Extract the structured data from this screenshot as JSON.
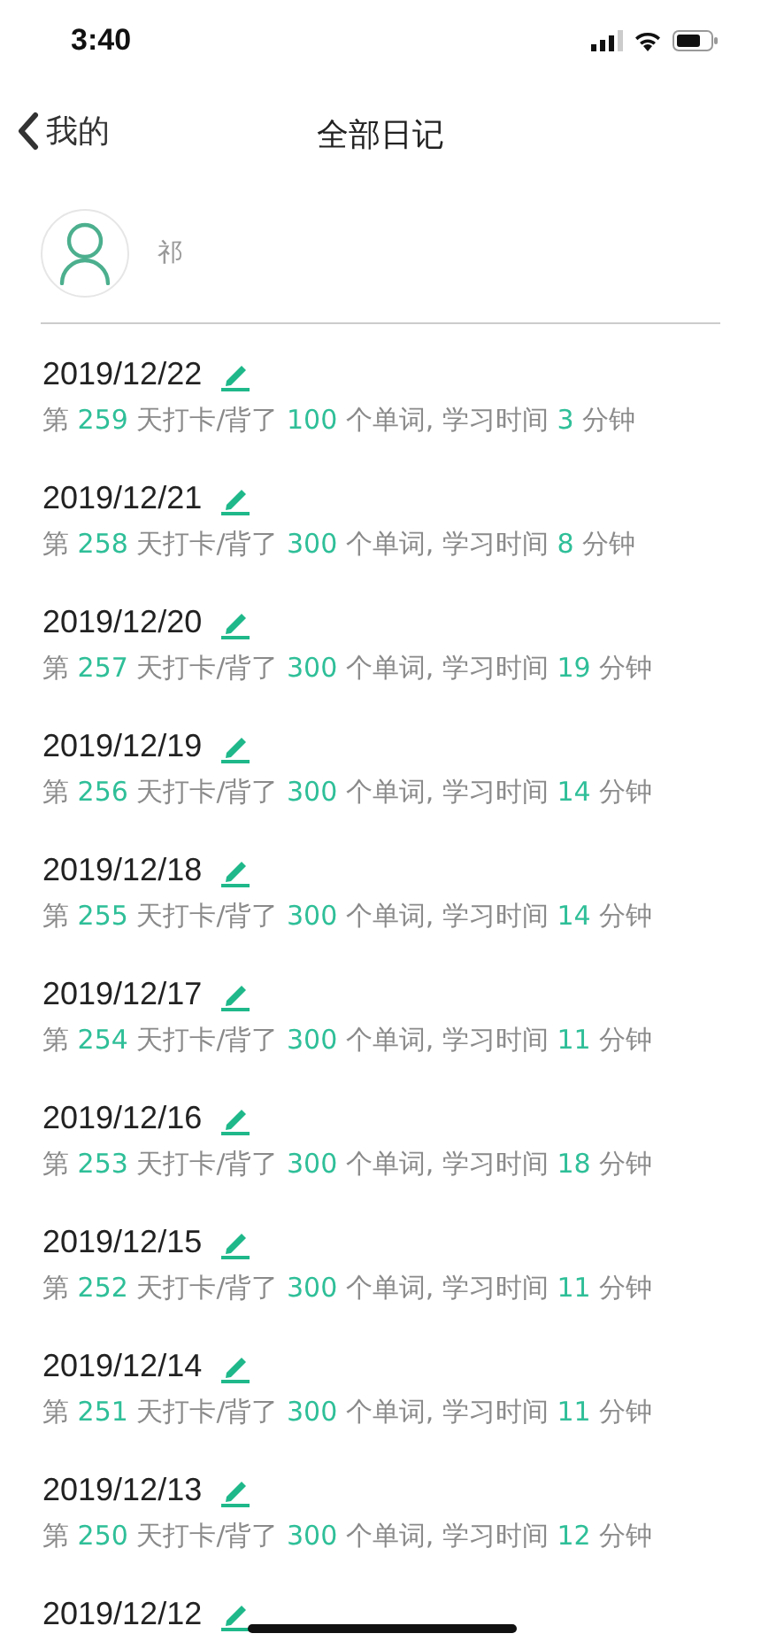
{
  "status_bar": {
    "time": "3:40"
  },
  "nav": {
    "back_label": "我的",
    "title": "全部日记"
  },
  "user": {
    "name": "祁"
  },
  "entries": [
    {
      "date": "2019/12/22",
      "parts": [
        {
          "kind": "plain",
          "text": "第 "
        },
        {
          "kind": "number",
          "text": "259"
        },
        {
          "kind": "plain",
          "text": " 天打卡/背了 "
        },
        {
          "kind": "number",
          "text": "100"
        },
        {
          "kind": "plain",
          "text": " 个单词, 学习时间 "
        },
        {
          "kind": "number",
          "text": "3"
        },
        {
          "kind": "plain",
          "text": " 分钟"
        }
      ]
    },
    {
      "date": "2019/12/21",
      "parts": [
        {
          "kind": "plain",
          "text": "第 "
        },
        {
          "kind": "number",
          "text": "258"
        },
        {
          "kind": "plain",
          "text": " 天打卡/背了 "
        },
        {
          "kind": "number",
          "text": "300"
        },
        {
          "kind": "plain",
          "text": " 个单词, 学习时间 "
        },
        {
          "kind": "number",
          "text": "8"
        },
        {
          "kind": "plain",
          "text": " 分钟"
        }
      ]
    },
    {
      "date": "2019/12/20",
      "parts": [
        {
          "kind": "plain",
          "text": "第 "
        },
        {
          "kind": "number",
          "text": "257"
        },
        {
          "kind": "plain",
          "text": " 天打卡/背了 "
        },
        {
          "kind": "number",
          "text": "300"
        },
        {
          "kind": "plain",
          "text": " 个单词, 学习时间 "
        },
        {
          "kind": "number",
          "text": "19"
        },
        {
          "kind": "plain",
          "text": " 分钟"
        }
      ]
    },
    {
      "date": "2019/12/19",
      "parts": [
        {
          "kind": "plain",
          "text": "第 "
        },
        {
          "kind": "number",
          "text": "256"
        },
        {
          "kind": "plain",
          "text": " 天打卡/背了 "
        },
        {
          "kind": "number",
          "text": "300"
        },
        {
          "kind": "plain",
          "text": " 个单词, 学习时间 "
        },
        {
          "kind": "number",
          "text": "14"
        },
        {
          "kind": "plain",
          "text": " 分钟"
        }
      ]
    },
    {
      "date": "2019/12/18",
      "parts": [
        {
          "kind": "plain",
          "text": "第 "
        },
        {
          "kind": "number",
          "text": "255"
        },
        {
          "kind": "plain",
          "text": " 天打卡/背了 "
        },
        {
          "kind": "number",
          "text": "300"
        },
        {
          "kind": "plain",
          "text": " 个单词, 学习时间 "
        },
        {
          "kind": "number",
          "text": "14"
        },
        {
          "kind": "plain",
          "text": " 分钟"
        }
      ]
    },
    {
      "date": "2019/12/17",
      "parts": [
        {
          "kind": "plain",
          "text": "第 "
        },
        {
          "kind": "number",
          "text": "254"
        },
        {
          "kind": "plain",
          "text": " 天打卡/背了 "
        },
        {
          "kind": "number",
          "text": "300"
        },
        {
          "kind": "plain",
          "text": " 个单词, 学习时间 "
        },
        {
          "kind": "number",
          "text": "11"
        },
        {
          "kind": "plain",
          "text": " 分钟"
        }
      ]
    },
    {
      "date": "2019/12/16",
      "parts": [
        {
          "kind": "plain",
          "text": "第 "
        },
        {
          "kind": "number",
          "text": "253"
        },
        {
          "kind": "plain",
          "text": " 天打卡/背了 "
        },
        {
          "kind": "number",
          "text": "300"
        },
        {
          "kind": "plain",
          "text": " 个单词, 学习时间 "
        },
        {
          "kind": "number",
          "text": "18"
        },
        {
          "kind": "plain",
          "text": " 分钟"
        }
      ]
    },
    {
      "date": "2019/12/15",
      "parts": [
        {
          "kind": "plain",
          "text": "第 "
        },
        {
          "kind": "number",
          "text": "252"
        },
        {
          "kind": "plain",
          "text": " 天打卡/背了 "
        },
        {
          "kind": "number",
          "text": "300"
        },
        {
          "kind": "plain",
          "text": " 个单词, 学习时间 "
        },
        {
          "kind": "number",
          "text": "11"
        },
        {
          "kind": "plain",
          "text": " 分钟"
        }
      ]
    },
    {
      "date": "2019/12/14",
      "parts": [
        {
          "kind": "plain",
          "text": "第 "
        },
        {
          "kind": "number",
          "text": "251"
        },
        {
          "kind": "plain",
          "text": " 天打卡/背了 "
        },
        {
          "kind": "number",
          "text": "300"
        },
        {
          "kind": "plain",
          "text": " 个单词, 学习时间 "
        },
        {
          "kind": "number",
          "text": "11"
        },
        {
          "kind": "plain",
          "text": " 分钟"
        }
      ]
    },
    {
      "date": "2019/12/13",
      "parts": [
        {
          "kind": "plain",
          "text": "第 "
        },
        {
          "kind": "number",
          "text": "250"
        },
        {
          "kind": "plain",
          "text": " 天打卡/背了 "
        },
        {
          "kind": "number",
          "text": "300"
        },
        {
          "kind": "plain",
          "text": " 个单词, 学习时间 "
        },
        {
          "kind": "number",
          "text": "12"
        },
        {
          "kind": "plain",
          "text": " 分钟"
        }
      ]
    },
    {
      "date": "2019/12/12"
    }
  ]
}
